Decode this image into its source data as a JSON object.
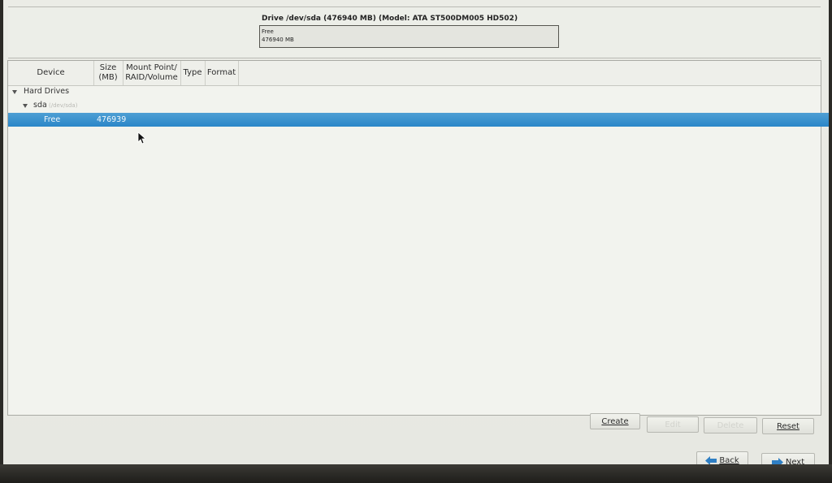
{
  "drive": {
    "title": "Drive /dev/sda (476940 MB) (Model: ATA ST500DM005 HD502)",
    "bar_line1": "Free",
    "bar_line2": "476940 MB"
  },
  "table": {
    "columns": {
      "device": "Device",
      "size_l1": "Size",
      "size_l2": "(MB)",
      "mount_l1": "Mount Point/",
      "mount_l2": "RAID/Volume",
      "type": "Type",
      "format": "Format"
    },
    "rows": {
      "hard_drives": "Hard Drives",
      "sda": "sda",
      "sda_path": "(/dev/sda)",
      "free_device": "Free",
      "free_size": "476939"
    }
  },
  "buttons": {
    "create": "Create",
    "edit": "Edit",
    "delete": "Delete",
    "reset": "Reset",
    "back": "Back",
    "next": "Next"
  },
  "colors": {
    "selection": "#2b86c8",
    "arrow": "#2f7fc4"
  },
  "icons": {
    "back": "arrow-left-icon",
    "next": "arrow-right-icon",
    "expander": "triangle-down-icon",
    "cursor": "mouse-pointer-icon"
  }
}
